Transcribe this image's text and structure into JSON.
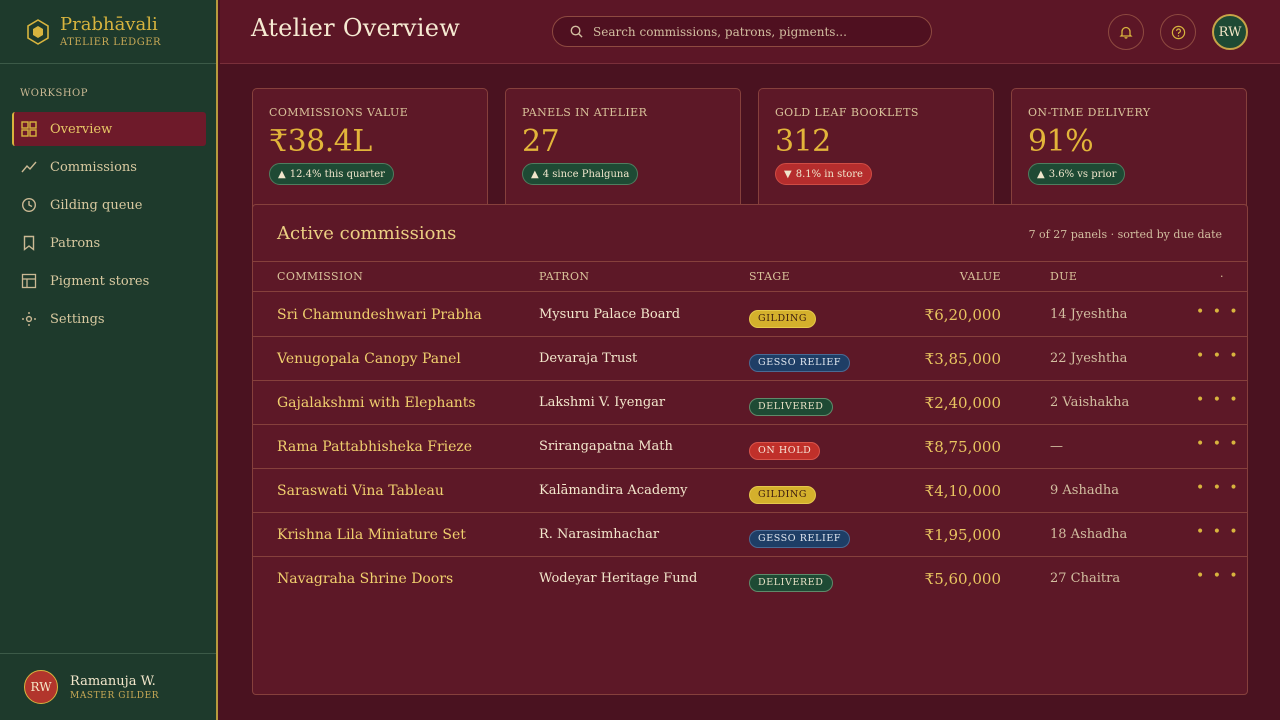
{
  "brand": {
    "name": "Prabhāvali",
    "subtitle": "ATELIER LEDGER"
  },
  "sidebar": {
    "section": "WORKSHOP",
    "items": [
      {
        "label": "Overview",
        "icon": "grid-icon",
        "active": true
      },
      {
        "label": "Commissions",
        "icon": "trend-line-icon"
      },
      {
        "label": "Gilding queue",
        "icon": "clock-icon"
      },
      {
        "label": "Patrons",
        "icon": "bookmark-icon"
      },
      {
        "label": "Pigment stores",
        "icon": "ledger-icon"
      },
      {
        "label": "Settings",
        "icon": "gear-icon"
      }
    ],
    "user": {
      "initials": "RW",
      "name": "Ramanuja W.",
      "role": "MASTER GILDER"
    }
  },
  "header": {
    "title": "Atelier Overview",
    "search_placeholder": "Search commissions, patrons, pigments...",
    "avatar_initials": "RW"
  },
  "kpis": [
    {
      "label": "COMMISSIONS VALUE",
      "value": "₹38.4L",
      "badge": "12.4% this quarter",
      "trend": "up"
    },
    {
      "label": "PANELS IN ATELIER",
      "value": "27",
      "badge": "4 since Phalguna",
      "trend": "up"
    },
    {
      "label": "GOLD LEAF BOOKLETS",
      "value": "312",
      "badge": "8.1% in store",
      "trend": "down"
    },
    {
      "label": "ON-TIME DELIVERY",
      "value": "91%",
      "badge": "3.6% vs prior",
      "trend": "up"
    }
  ],
  "panel": {
    "title": "Active commissions",
    "meta": "7 of 27 panels · sorted by due date",
    "columns": {
      "commission": "COMMISSION",
      "patron": "PATRON",
      "stage": "STAGE",
      "value": "VALUE",
      "due": "DUE",
      "actions": "·"
    },
    "rows": [
      {
        "commission": "Sri Chamundeshwari Prabha",
        "patron": "Mysuru Palace Board",
        "stage": "GILDING",
        "stage_kind": "gilding",
        "value": "₹6,20,000",
        "due": "14 Jyeshtha"
      },
      {
        "commission": "Venugopala Canopy Panel",
        "patron": "Devaraja Trust",
        "stage": "GESSO RELIEF",
        "stage_kind": "gesso",
        "value": "₹3,85,000",
        "due": "22 Jyeshtha"
      },
      {
        "commission": "Gajalakshmi with Elephants",
        "patron": "Lakshmi V. Iyengar",
        "stage": "DELIVERED",
        "stage_kind": "delivered",
        "value": "₹2,40,000",
        "due": "2 Vaishakha"
      },
      {
        "commission": "Rama Pattabhisheka Frieze",
        "patron": "Srirangapatna Math",
        "stage": "ON HOLD",
        "stage_kind": "hold",
        "value": "₹8,75,000",
        "due": "—"
      },
      {
        "commission": "Saraswati Vina Tableau",
        "patron": "Kalāmandira Academy",
        "stage": "GILDING",
        "stage_kind": "gilding",
        "value": "₹4,10,000",
        "due": "9 Ashadha"
      },
      {
        "commission": "Krishna Lila Miniature Set",
        "patron": "R. Narasimhachar",
        "stage": "GESSO RELIEF",
        "stage_kind": "gesso",
        "value": "₹1,95,000",
        "due": "18 Ashadha"
      },
      {
        "commission": "Navagraha Shrine Doors",
        "patron": "Wodeyar Heritage Fund",
        "stage": "DELIVERED",
        "stage_kind": "delivered",
        "value": "₹5,60,000",
        "due": "27 Chaitra"
      }
    ],
    "row_action_label": "• • •"
  },
  "colors": {
    "gold": "#d8b43e",
    "maroon": "#5d1827",
    "forest": "#1e3a2c"
  }
}
